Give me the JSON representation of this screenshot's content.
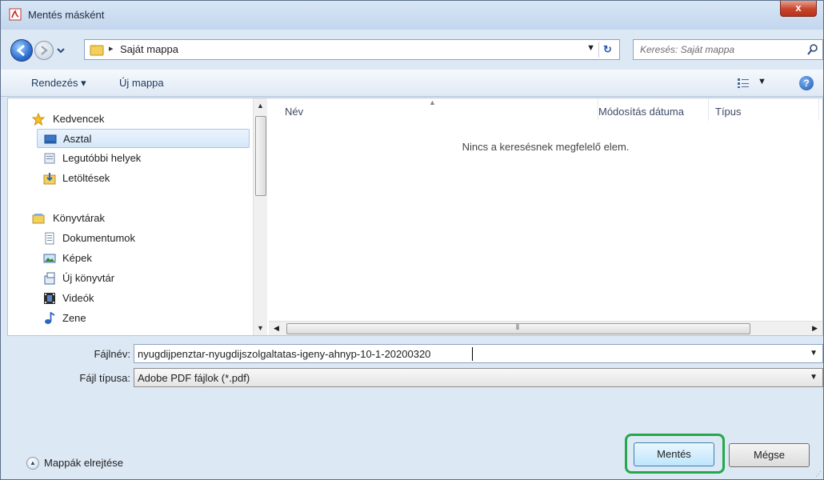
{
  "window": {
    "title": "Mentés másként",
    "close_label": "x"
  },
  "address": {
    "separator": "▸",
    "path": "Saját mappa"
  },
  "search": {
    "placeholder": "Keresés: Saját mappa"
  },
  "toolbar": {
    "organize_label": "Rendezés ▾",
    "new_folder_label": "Új mappa",
    "help_label": "?"
  },
  "nav": {
    "favorites_header": "Kedvencek",
    "favorites": [
      {
        "label": "Asztal",
        "icon": "desktop-icon"
      },
      {
        "label": "Legutóbbi helyek",
        "icon": "recent-places-icon"
      },
      {
        "label": "Letöltések",
        "icon": "downloads-icon"
      }
    ],
    "libraries_header": "Könyvtárak",
    "libraries": [
      {
        "label": "Dokumentumok",
        "icon": "documents-icon"
      },
      {
        "label": "Képek",
        "icon": "pictures-icon"
      },
      {
        "label": "Új könyvtár",
        "icon": "library-icon"
      },
      {
        "label": "Videók",
        "icon": "videos-icon"
      },
      {
        "label": "Zene",
        "icon": "music-icon"
      }
    ]
  },
  "list": {
    "columns": [
      "Név",
      "Módosítás dátuma",
      "Típus"
    ],
    "empty_message": "Nincs a keresésnek megfelelő elem."
  },
  "form": {
    "filename_label": "Fájlnév:",
    "filename_value": "nyugdijpenztar-nyugdijszolgaltatas-igeny-ahnyp-10-1-20200320",
    "filetype_label": "Fájl típusa:",
    "filetype_value": "Adobe PDF fájlok (*.pdf)"
  },
  "footer": {
    "hide_folders_label": "Mappák elrejtése",
    "save_label": "Mentés",
    "cancel_label": "Mégse"
  },
  "colors": {
    "highlight": "#24a84b",
    "selection": "#d6e7fa"
  }
}
